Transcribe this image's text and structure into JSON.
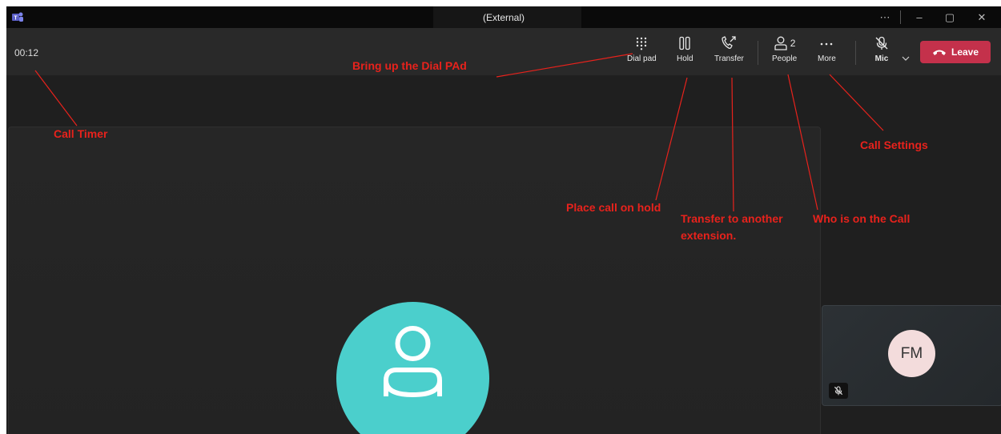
{
  "window": {
    "title": "(External)",
    "controls": [
      "⋯",
      "–",
      "▢",
      "✕"
    ]
  },
  "toolbar": {
    "timer": "00:12",
    "dial_pad": "Dial pad",
    "hold": "Hold",
    "transfer": "Transfer",
    "people": "People",
    "people_count": "2",
    "more": "More",
    "mic": "Mic",
    "leave": "Leave"
  },
  "self_view": {
    "initials": "FM"
  },
  "annotations": {
    "call_timer": "Call Timer",
    "dial_pad": "Bring up the Dial PAd",
    "hold": "Place call on hold",
    "transfer_line1": "Transfer to another",
    "transfer_line2": "extension.",
    "people": "Who is on the Call",
    "settings": "Call Settings"
  },
  "colors": {
    "leave_button": "#c4314b",
    "annotation": "#e8221c",
    "remote_avatar": "#4bcfcc",
    "self_avatar": "#f3dcdc"
  }
}
